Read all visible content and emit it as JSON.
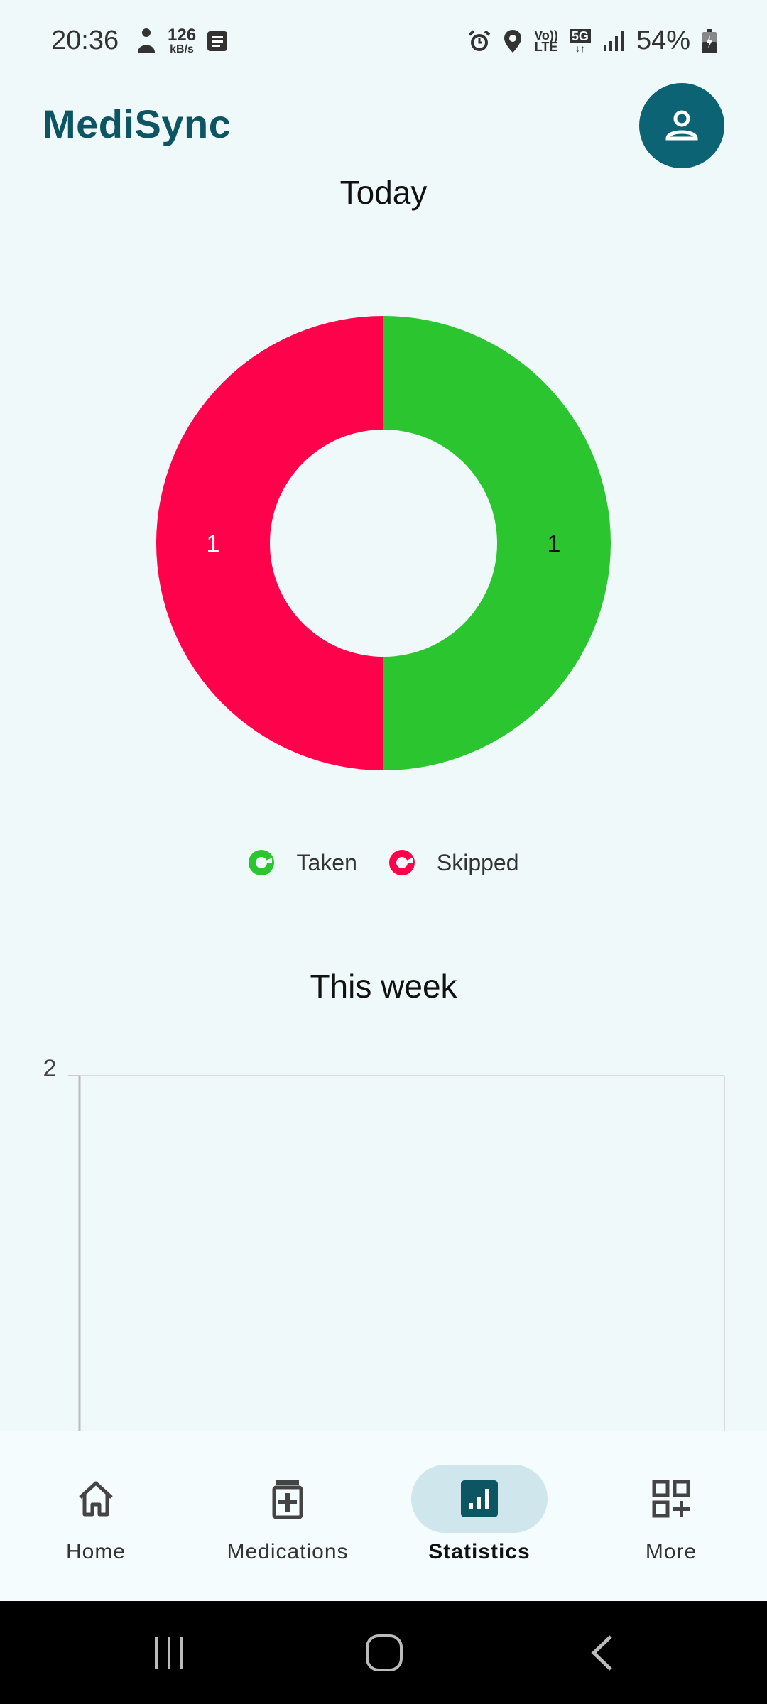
{
  "status_bar": {
    "time": "20:36",
    "net_speed_value": "126",
    "net_speed_unit": "kB/s",
    "volte_top": "Vo))",
    "volte_bottom": "LTE",
    "network": "5G",
    "battery": "54%",
    "icons": [
      "person-icon",
      "notes-icon",
      "alarm-icon",
      "location-icon",
      "signal-icon",
      "battery-icon"
    ]
  },
  "app_bar": {
    "title": "MediSync",
    "avatar_icon": "person-icon"
  },
  "today": {
    "title": "Today",
    "legend": [
      {
        "label": "Taken",
        "color": "#2bc52f"
      },
      {
        "label": "Skipped",
        "color": "#ff024c"
      }
    ]
  },
  "week": {
    "title": "This week",
    "y_tick_top": "2"
  },
  "chart_data": [
    {
      "type": "pie",
      "style": "donut",
      "categories": [
        "Taken",
        "Skipped"
      ],
      "values": [
        1,
        1
      ],
      "colors": [
        "#2bc52f",
        "#ff024c"
      ],
      "data_labels": [
        "1",
        "1"
      ],
      "title": "Today",
      "legend": "bottom"
    },
    {
      "type": "bar",
      "title": "This week",
      "y_ticks_visible": [
        "2"
      ],
      "ylim_top": 2,
      "grid": true
    }
  ],
  "bottom_nav": {
    "items": [
      {
        "label": "Home",
        "icon": "home-icon",
        "active": false
      },
      {
        "label": "Medications",
        "icon": "medication-icon",
        "active": false
      },
      {
        "label": "Statistics",
        "icon": "statistics-icon",
        "active": true
      },
      {
        "label": "More",
        "icon": "more-icon",
        "active": false
      }
    ]
  },
  "system_nav": {
    "icons": [
      "recents-icon",
      "home-circle-icon",
      "back-icon"
    ]
  },
  "colors": {
    "brand": "#0d5563",
    "avatar_bg": "#0b6374",
    "background": "#f0f9f9",
    "taken": "#2bc52f",
    "skipped": "#ff024c"
  }
}
